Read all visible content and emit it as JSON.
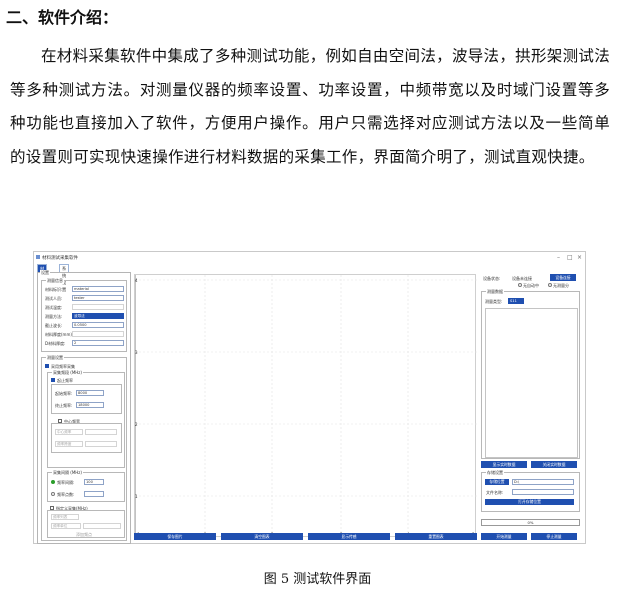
{
  "doc": {
    "heading": "二、软件介绍：",
    "paragraph": "在材料采集软件中集成了多种测试功能，例如自由空间法，波导法，拱形架测试法等多种测试方法。对测量仪器的频率设置、功率设置，中频带宽以及时域门设置等多种功能也直接加入了软件，方便用户操作。用户只需选择对应测试方法以及一些简单的设置则可实现快速操作进行材料数据的采集工作，界面简介明了，测试直观快捷。",
    "caption": "图 5  测试软件界面"
  },
  "app": {
    "window_title": "材料测试采集软件",
    "tabs": [
      "材料测量",
      "系统设置"
    ],
    "left": {
      "settings_group": "设置",
      "measure_info": "测量信息",
      "fields": [
        {
          "label": "材料标识:",
          "value": "material"
        },
        {
          "label": "测试人员:",
          "value": "tester"
        },
        {
          "label": "测试温度:",
          "value": ""
        }
      ],
      "method_label": "测量方法:",
      "method_value": "波导法",
      "cutoff_label": "截止波长:",
      "cutoff_value": "0.0500",
      "thickness_label": "材料厚度(mm):",
      "thickness_value": "",
      "d_label": "D材料厚度:",
      "d_value": "2",
      "meas_settings": "测量设置",
      "freq_sweep": "采用频率采集",
      "freq_range": "采集频段 (MHz)",
      "startstop": "起止频率",
      "start_label": "起始频率:",
      "start_value": "8000",
      "stop_label": "终止频率:",
      "stop_value": "18000",
      "center": "中心频宽",
      "center_freq": "中心频率",
      "span": "频率跨度",
      "interval_group": "采集间隔 (MHz)",
      "interval_label": "频率间隔:",
      "interval_value": "100",
      "points_label": "频率点数:",
      "custom": "指定义采集(MHz)",
      "custom_f1": "频率列表",
      "custom_f2": "频率单位",
      "custom_btn": "添加频点"
    },
    "plot": {
      "yticks": [
        "4",
        "3",
        "2",
        "1",
        "0"
      ],
      "xticks": [
        "0",
        "1",
        "2",
        "3",
        "4",
        "5"
      ]
    },
    "bottom_buttons": [
      "保存图片",
      "清空图表",
      "显示传感",
      "重置图表"
    ],
    "right": {
      "device_status_label": "设备状态:",
      "device_status_value": "设备未连接",
      "connect_btn": "设备连接",
      "opt1": "无自动中",
      "opt2": "无测量分",
      "data_group": "测量数据",
      "type_label": "测量类型:",
      "type_value": "S11",
      "show_realtime": "显示实时数据",
      "close_realtime": "关闭实时数据",
      "storage_group": "存储设置",
      "storage_path_label": "存储位置",
      "storage_path_value": "D:\\",
      "file_label": "文件名称:",
      "open_btn": "打开存储位置",
      "progress": "0%",
      "start_btn": "开始测量",
      "stop_btn": "停止测量"
    },
    "colors": {
      "accent": "#1f4fb0",
      "radio_on": "#2a9d2a"
    }
  }
}
